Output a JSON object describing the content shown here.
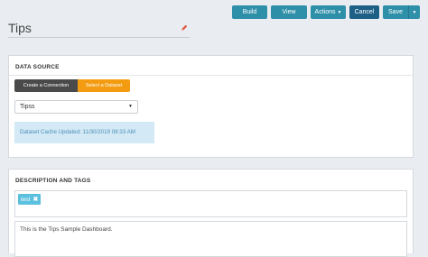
{
  "toolbar": {
    "build_label": "Build",
    "view_label": "View",
    "actions_label": "Actions",
    "cancel_label": "Cancel",
    "save_label": "Save"
  },
  "page": {
    "title": "Tips",
    "edit_icon": "pencil-icon"
  },
  "data_source": {
    "heading": "DATA SOURCE",
    "create_connection_label": "Create a Connection",
    "select_dataset_label": "Select a Dataset",
    "selected_dataset": "Tipss",
    "cache_info": "Dataset Cache Updated: 11/30/2019 08:33 AM"
  },
  "description_tags": {
    "heading": "DESCRIPTION AND TAGS",
    "tags": [
      "test"
    ],
    "description": "This is the Tips Sample Dashboard."
  },
  "colors": {
    "primary_button": "#2e8fa8",
    "cancel_button": "#1e5f86",
    "select_dataset_accent": "#f39c12",
    "tag": "#5bc0de",
    "info_box": "#d3e9f5"
  }
}
